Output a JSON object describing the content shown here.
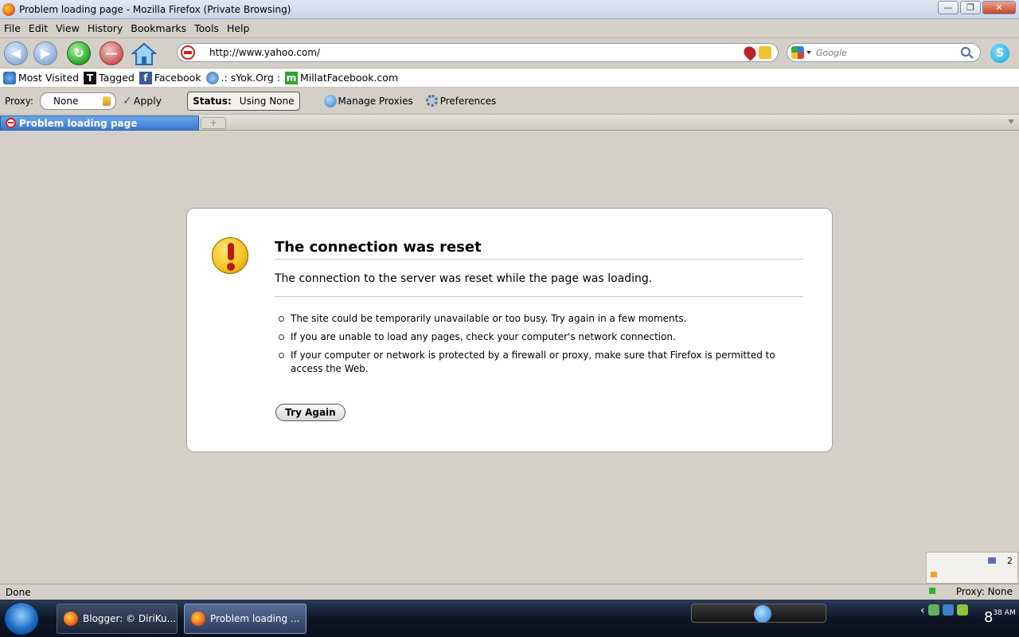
{
  "window": {
    "title": "Problem loading page - Mozilla Firefox (Private Browsing)",
    "minimize": "—",
    "restore": "❐",
    "close": "✕"
  },
  "menu": [
    "File",
    "Edit",
    "View",
    "History",
    "Bookmarks",
    "Tools",
    "Help"
  ],
  "nav": {
    "url": "http://www.yahoo.com/",
    "search_placeholder": "Google"
  },
  "bookmarks": [
    {
      "label": "Most Visited",
      "icon": "most-visited-icon"
    },
    {
      "label": "Tagged",
      "icon": "tagged-icon"
    },
    {
      "label": "Facebook",
      "icon": "facebook-icon"
    },
    {
      "label": ".: sYok.Org :",
      "icon": "syok-icon"
    },
    {
      "label": "MillatFacebook.com",
      "icon": "millat-icon"
    }
  ],
  "proxybar": {
    "label": "Proxy:",
    "selected": "None",
    "apply": "Apply",
    "status_label": "Status:",
    "status_value": "Using None",
    "manage": "Manage Proxies",
    "preferences": "Preferences"
  },
  "tab": {
    "title": "Problem loading page",
    "new_tab": "+"
  },
  "error": {
    "title": "The connection was reset",
    "description": "The connection to the server was reset while the page was loading.",
    "items": [
      "The site could be temporarily unavailable or too busy. Try again in a few moments.",
      "If you are unable to load any pages, check your computer's network connection.",
      "If your computer or network is protected by a firewall or proxy, make sure that Firefox is permitted to access the Web."
    ],
    "button": "Try Again"
  },
  "widget": {
    "count": "2"
  },
  "status": {
    "text": "Done",
    "proxy": "Proxy: None"
  },
  "taskbar": {
    "items": [
      {
        "label": "Blogger: © DiriKu...",
        "active": false
      },
      {
        "label": "Problem loading ...",
        "active": true
      }
    ],
    "clock_hour": "8",
    "clock_min": "38",
    "clock_ampm": "AM"
  }
}
